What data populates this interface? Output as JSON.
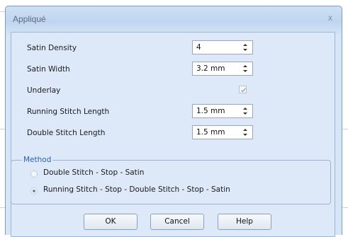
{
  "dialog": {
    "title": "Appliqué",
    "close_glyph": "x"
  },
  "fields": [
    {
      "label": "Satin Density",
      "value": "4"
    },
    {
      "label": "Satin Width",
      "value": "3.2 mm"
    },
    {
      "label": "Underlay",
      "checked": true
    },
    {
      "label": "Running Stitch Length",
      "value": "1.5 mm"
    },
    {
      "label": "Double Stitch Length",
      "value": "1.5 mm"
    }
  ],
  "method": {
    "legend": "Method",
    "options": [
      {
        "label": "Double Stitch - Stop - Satin",
        "selected": false
      },
      {
        "label": "Running Stitch - Stop - Double Stitch - Stop - Satin",
        "selected": true
      }
    ]
  },
  "buttons": {
    "ok": "OK",
    "cancel": "Cancel",
    "help": "Help"
  },
  "icons": [
    "close-icon",
    "spinner-up-icon",
    "spinner-down-icon",
    "checkmark-icon"
  ]
}
